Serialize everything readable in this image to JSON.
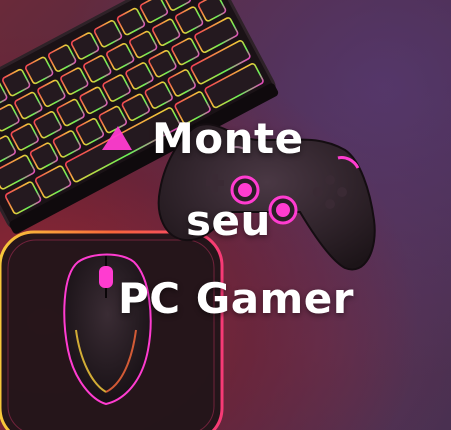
{
  "headline": {
    "line1": "Monte",
    "line2": "seu",
    "line3": "PC Gamer"
  },
  "colors": {
    "background_red": "#a8283a",
    "background_purple": "#3d2e4e",
    "rgb_glow_pink": "#ff3cd0",
    "rgb_glow_yellow": "#ffd23c",
    "rgb_glow_green": "#6cff5a",
    "text": "#ffffff"
  },
  "icons": {
    "keyboard": "keyboard-icon",
    "gamepad": "gamepad-icon",
    "mouse": "mouse-icon",
    "mousepad": "mousepad-icon"
  }
}
